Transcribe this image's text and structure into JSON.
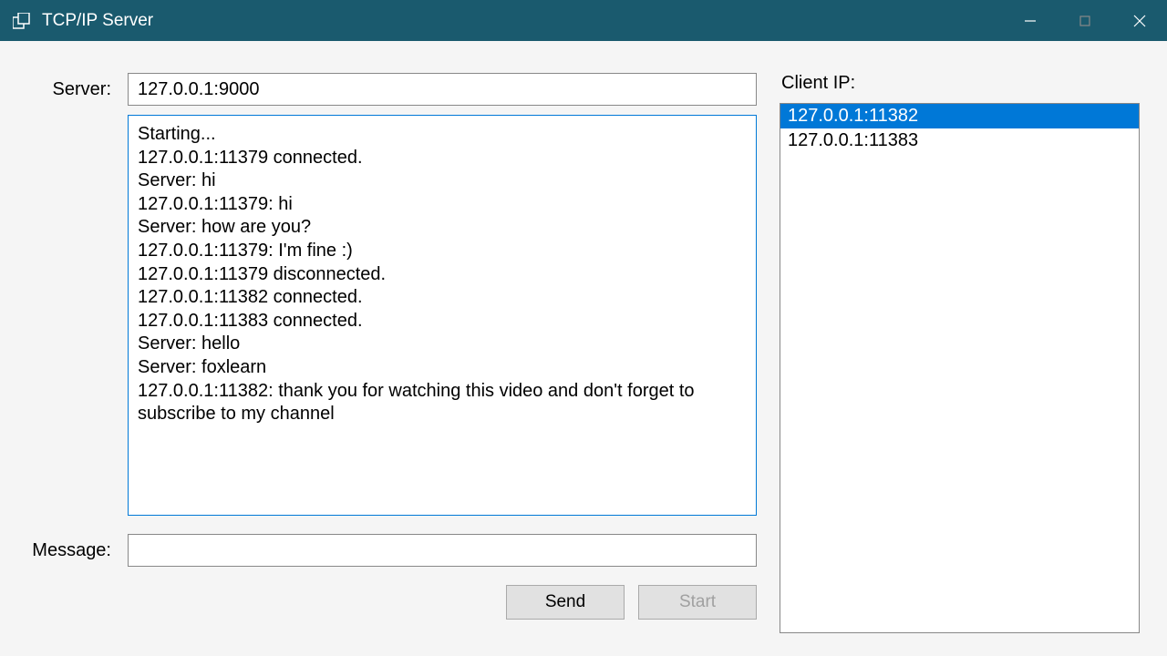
{
  "window": {
    "title": "TCP/IP Server"
  },
  "labels": {
    "server": "Server:",
    "client_ip": "Client IP:",
    "message": "Message:"
  },
  "fields": {
    "server_address": "127.0.0.1:9000",
    "message_value": ""
  },
  "log": {
    "lines": [
      "Starting...",
      "127.0.0.1:11379 connected.",
      "Server: hi",
      "127.0.0.1:11379: hi",
      "Server: how are you?",
      "127.0.0.1:11379: I'm fine :)",
      "127.0.0.1:11379 disconnected.",
      "127.0.0.1:11382 connected.",
      "127.0.0.1:11383 connected.",
      "Server: hello",
      "Server: foxlearn",
      "127.0.0.1:11382: thank you for watching this video and don't forget to subscribe to my channel"
    ]
  },
  "clients": {
    "items": [
      {
        "address": "127.0.0.1:11382",
        "selected": true
      },
      {
        "address": "127.0.0.1:11383",
        "selected": false
      }
    ]
  },
  "buttons": {
    "send": "Send",
    "start": "Start"
  }
}
